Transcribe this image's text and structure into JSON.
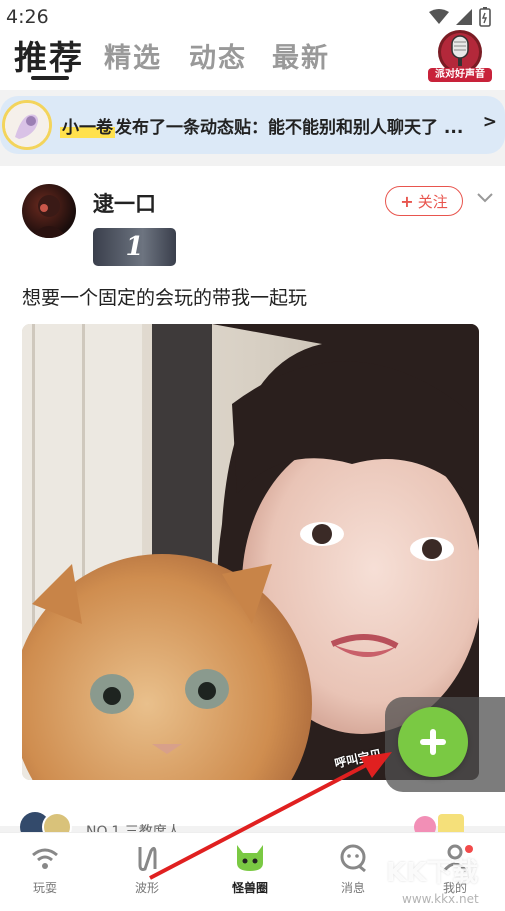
{
  "status_bar": {
    "time": "4:26"
  },
  "header": {
    "tabs": [
      {
        "label": "推荐",
        "active": true
      },
      {
        "label": "精选",
        "active": false
      },
      {
        "label": "动态",
        "active": false
      },
      {
        "label": "最新",
        "active": false
      }
    ],
    "badge_label": "派对好声音"
  },
  "notice": {
    "name": "小一卷",
    "message": "发布了一条动态贴：能不能别和别人聊天了 ...",
    "arrow": ">"
  },
  "post": {
    "username": "逮一口",
    "level": "1",
    "follow_label": "关注",
    "text": "想要一个固定的会玩的带我一起玩",
    "image_caption": "呼叫宝贝"
  },
  "next_post": {
    "preview_text": "NO.1 三教席人"
  },
  "bottom_nav": {
    "items": [
      {
        "label": "玩耍",
        "icon": "wifi-icon"
      },
      {
        "label": "波形",
        "icon": "wave-icon"
      },
      {
        "label": "怪兽圈",
        "icon": "monster-icon"
      },
      {
        "label": "消息",
        "icon": "message-icon"
      },
      {
        "label": "我的",
        "icon": "profile-icon"
      }
    ]
  },
  "watermark": {
    "text": "KK下载",
    "url": "www.kkx.net"
  },
  "colors": {
    "accent_green": "#7ac943",
    "follow_red": "#e8554e",
    "notice_bg": "#dce9f7",
    "highlight_yellow": "#ffe14d"
  }
}
